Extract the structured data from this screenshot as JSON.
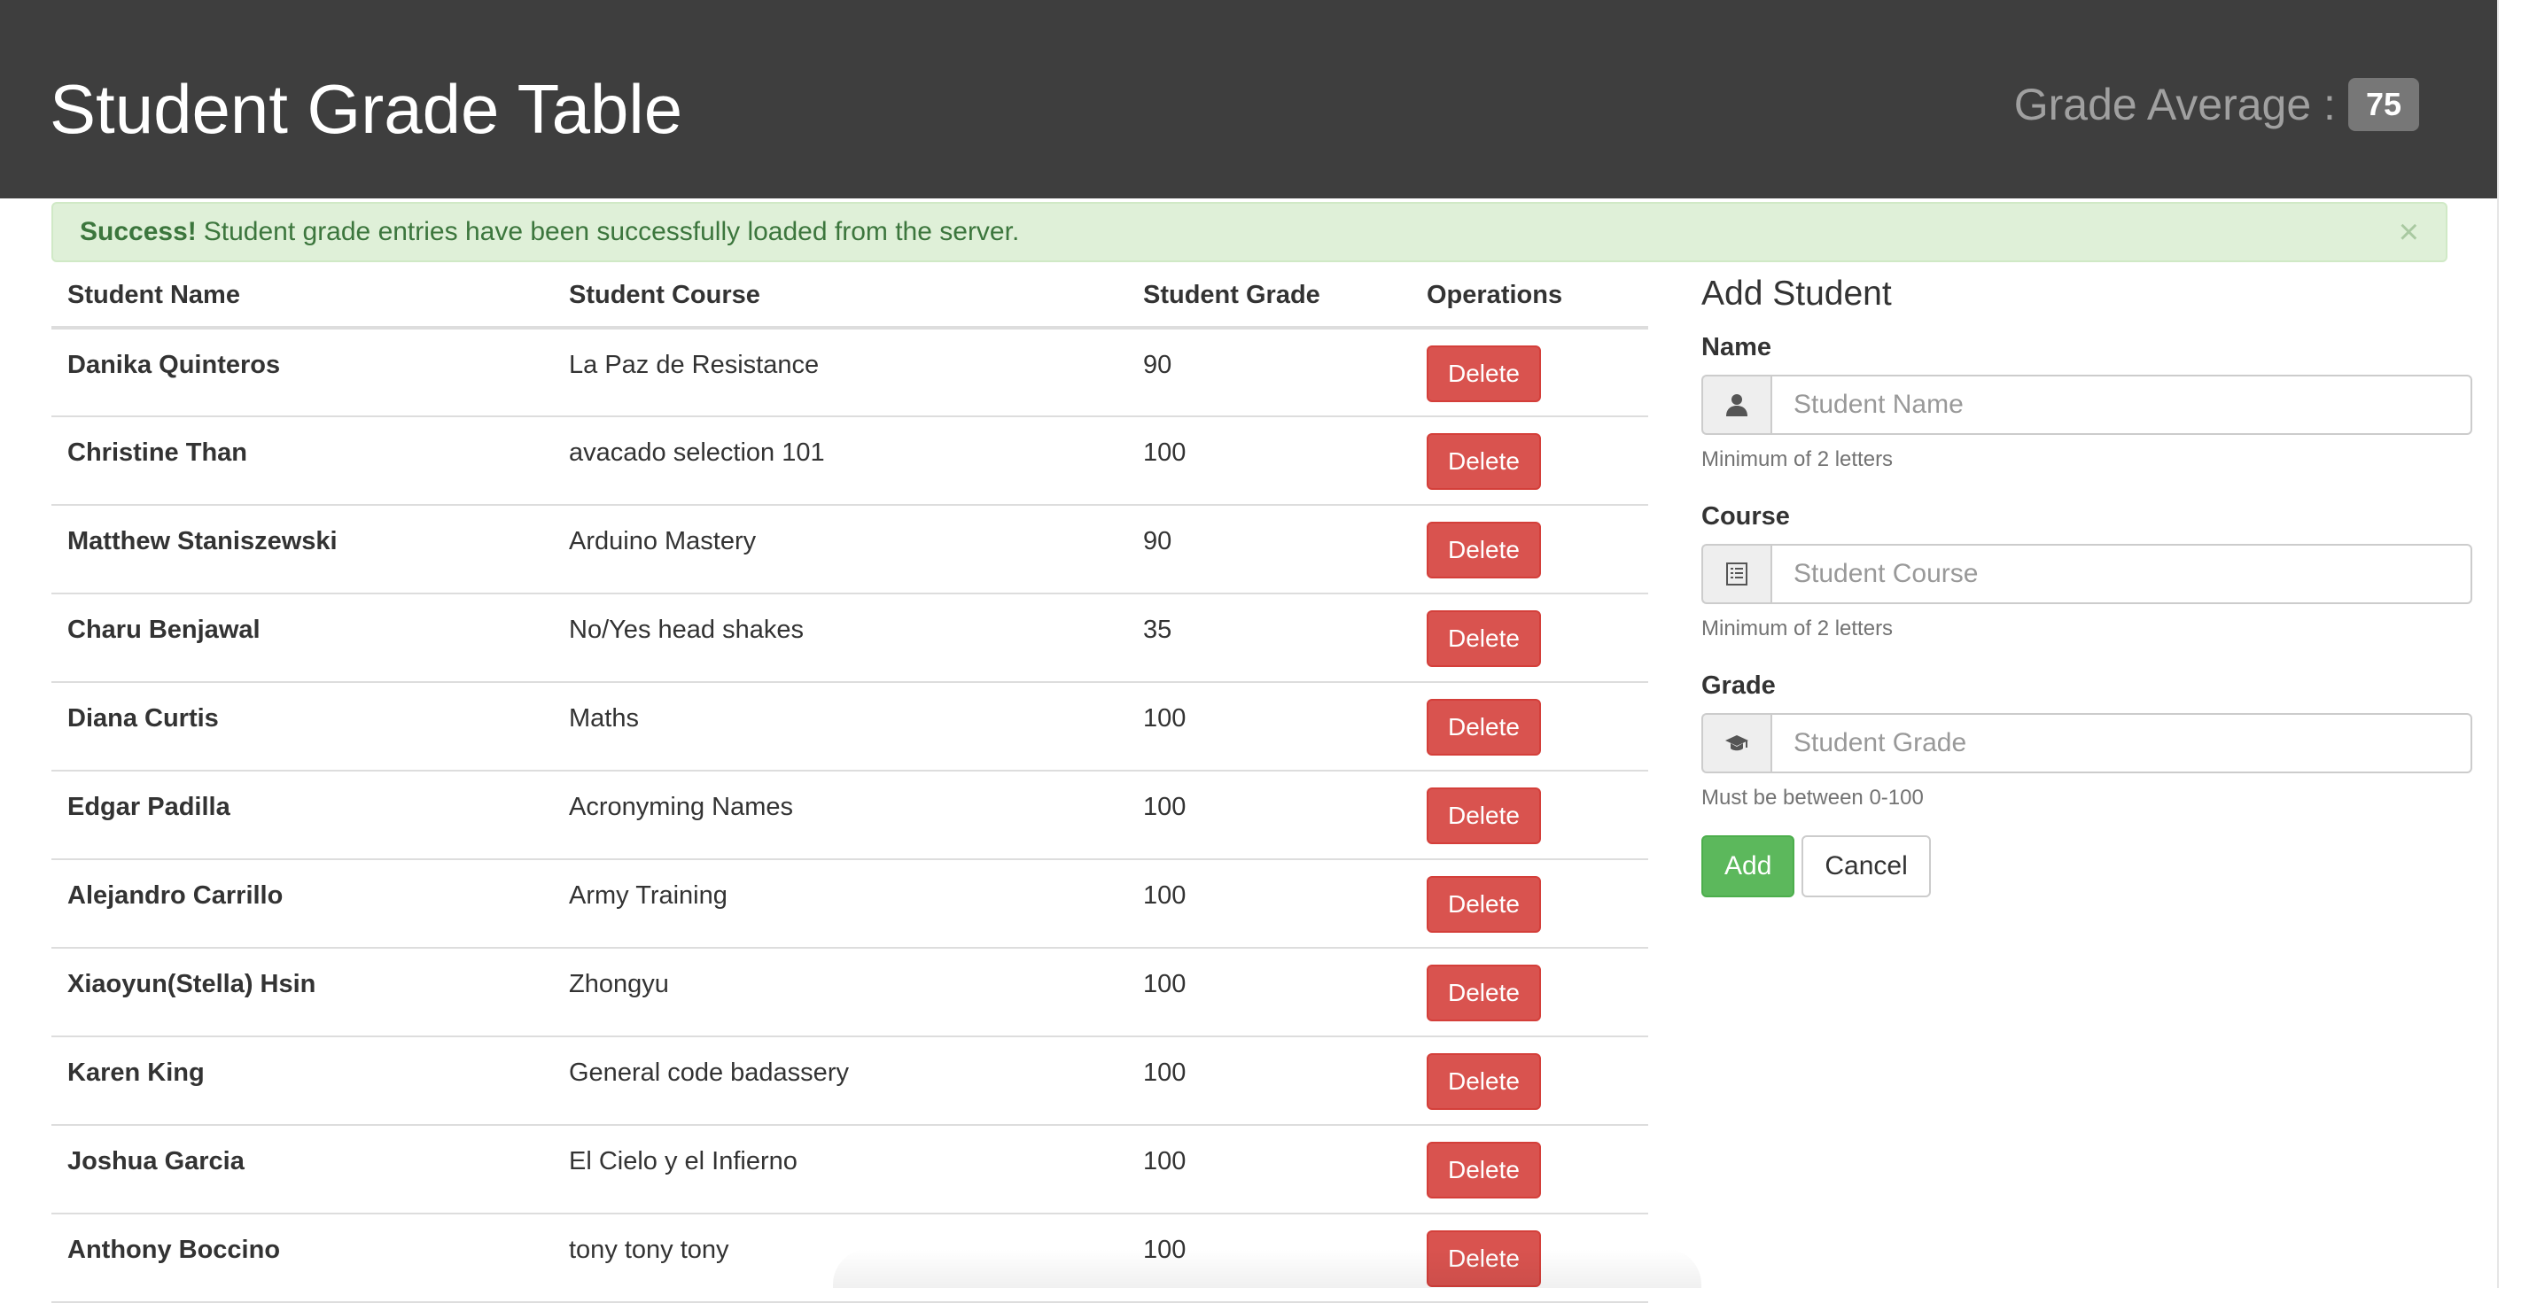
{
  "header": {
    "title": "Student Grade Table",
    "average_label": "Grade Average :",
    "average_value": "75"
  },
  "alert": {
    "strong": "Success!",
    "message": "Student grade entries have been successfully loaded from the server.",
    "close": "×"
  },
  "table": {
    "columns": [
      "Student Name",
      "Student Course",
      "Student Grade",
      "Operations"
    ],
    "delete_label": "Delete",
    "rows": [
      {
        "name": "Danika Quinteros",
        "course": "La Paz de Resistance",
        "grade": "90"
      },
      {
        "name": "Christine Than",
        "course": "avacado selection 101",
        "grade": "100"
      },
      {
        "name": "Matthew Staniszewski",
        "course": "Arduino Mastery",
        "grade": "90"
      },
      {
        "name": "Charu Benjawal",
        "course": "No/Yes head shakes",
        "grade": "35"
      },
      {
        "name": "Diana Curtis",
        "course": "Maths",
        "grade": "100"
      },
      {
        "name": "Edgar Padilla",
        "course": "Acronyming Names",
        "grade": "100"
      },
      {
        "name": "Alejandro Carrillo",
        "course": "Army Training",
        "grade": "100"
      },
      {
        "name": "Xiaoyun(Stella) Hsin",
        "course": "Zhongyu",
        "grade": "100"
      },
      {
        "name": "Karen King",
        "course": "General code badassery",
        "grade": "100"
      },
      {
        "name": "Joshua Garcia",
        "course": "El Cielo y el Infierno",
        "grade": "100"
      },
      {
        "name": "Anthony Boccino",
        "course": "tony tony tony",
        "grade": "100"
      }
    ]
  },
  "form": {
    "title": "Add Student",
    "name": {
      "label": "Name",
      "placeholder": "Student Name",
      "value": "",
      "help": "Minimum of 2 letters",
      "icon": "user-icon"
    },
    "course": {
      "label": "Course",
      "placeholder": "Student Course",
      "value": "",
      "help": "Minimum of 2 letters",
      "icon": "list-icon"
    },
    "grade": {
      "label": "Grade",
      "placeholder": "Student Grade",
      "value": "",
      "help": "Must be between 0-100",
      "icon": "graduation-cap-icon"
    },
    "add_label": "Add",
    "cancel_label": "Cancel"
  },
  "colors": {
    "header_bg": "#3e3e3e",
    "success_bg": "#dff0d8",
    "danger": "#d9534f",
    "add": "#5cb85c"
  }
}
